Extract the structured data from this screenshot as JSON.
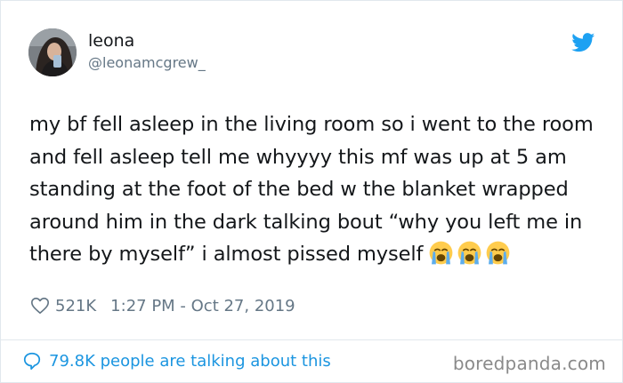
{
  "user": {
    "name": "leona",
    "handle": "@leonamcgrew_"
  },
  "tweet": {
    "text": "my bf fell asleep in the living room so i went to the room and fell asleep tell me whyyyy this mf was up at 5 am standing at the foot of the bed w the blanket wrapped around him in the dark talking bout “why you left me in there by myself” i almost pissed myself",
    "emojis": [
      "loudly-crying-face",
      "loudly-crying-face",
      "loudly-crying-face"
    ]
  },
  "meta": {
    "likes": "521K",
    "timestamp": "1:27 PM - Oct 27, 2019"
  },
  "footer": {
    "talking": "79.8K people are talking about this",
    "watermark": "boredpanda.com"
  },
  "colors": {
    "twitter_blue": "#1da1f2",
    "link_blue": "#1b95e0",
    "muted": "#657786",
    "text": "#14171a",
    "border": "#e1e8ed"
  }
}
